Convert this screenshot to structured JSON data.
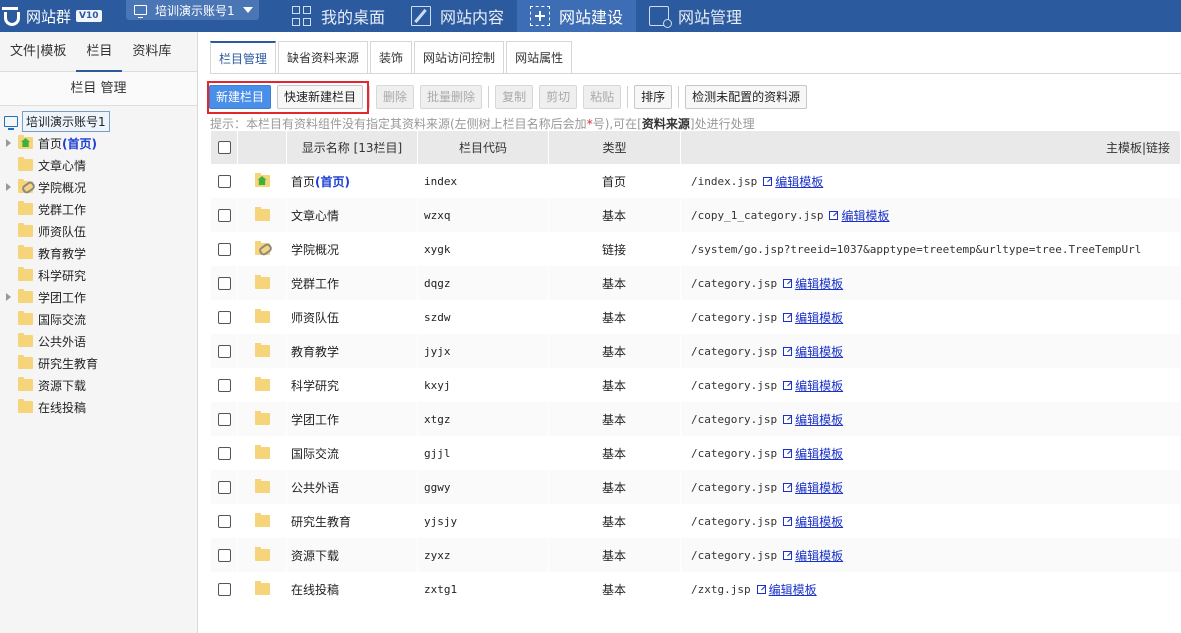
{
  "app": {
    "logo_text": "网站群",
    "version": "V10",
    "account": "培训演示账号1"
  },
  "topnav": [
    {
      "label": "我的桌面",
      "icon": "desktop-icon"
    },
    {
      "label": "网站内容",
      "icon": "edit-icon"
    },
    {
      "label": "网站建设",
      "icon": "build-icon",
      "active": true
    },
    {
      "label": "网站管理",
      "icon": "manage-icon"
    }
  ],
  "left": {
    "tabs": [
      "文件|模板",
      "栏目",
      "资料库"
    ],
    "active_tab": "栏目",
    "title": "栏目 管理",
    "root": "培训演示账号1",
    "tree": [
      {
        "label": "首页",
        "tag": "(首页)",
        "expandable": true,
        "icon": "home-folder-icon"
      },
      {
        "label": "文章心情",
        "expandable": false,
        "icon": "folder-icon"
      },
      {
        "label": "学院概况",
        "expandable": true,
        "icon": "link-folder-icon"
      },
      {
        "label": "党群工作",
        "expandable": false,
        "icon": "folder-icon"
      },
      {
        "label": "师资队伍",
        "expandable": false,
        "icon": "folder-icon"
      },
      {
        "label": "教育教学",
        "expandable": false,
        "icon": "folder-icon"
      },
      {
        "label": "科学研究",
        "expandable": false,
        "icon": "folder-icon"
      },
      {
        "label": "学团工作",
        "expandable": true,
        "icon": "folder-icon"
      },
      {
        "label": "国际交流",
        "expandable": false,
        "icon": "folder-icon"
      },
      {
        "label": "公共外语",
        "expandable": false,
        "icon": "folder-icon"
      },
      {
        "label": "研究生教育",
        "expandable": false,
        "icon": "folder-icon"
      },
      {
        "label": "资源下载",
        "expandable": false,
        "icon": "folder-icon"
      },
      {
        "label": "在线投稿",
        "expandable": false,
        "icon": "folder-icon"
      }
    ]
  },
  "main": {
    "tabs": [
      "栏目管理",
      "缺省资料来源",
      "装饰",
      "网站访问控制",
      "网站属性"
    ],
    "toolbar": {
      "new": "新建栏目",
      "quick_new": "快速新建栏目",
      "delete": "删除",
      "batch_delete": "批量删除",
      "copy": "复制",
      "cut": "剪切",
      "paste": "粘贴",
      "sort": "排序",
      "check": "检测未配置的资料源"
    },
    "hint": {
      "prefix": "提示：本栏目有资料组件没有指定其资料来源(左侧树上栏目名称后会加",
      "star": "*",
      "middle": "号),可在[",
      "source": "资料来源",
      "suffix": "]处进行处理"
    },
    "columns": {
      "name": "显示名称 [13栏目]",
      "code": "栏目代码",
      "type": "类型",
      "template": "主模板|链接"
    },
    "edit_label": "编辑模板",
    "rows": [
      {
        "name": "首页",
        "tag": "(首页)",
        "code": "index",
        "type": "首页",
        "template": "/index.jsp",
        "icon": "home-folder-icon",
        "editable": true
      },
      {
        "name": "文章心情",
        "code": "wzxq",
        "type": "基本",
        "template": "/copy_1_category.jsp",
        "icon": "folder-icon",
        "editable": true
      },
      {
        "name": "学院概况",
        "code": "xygk",
        "type": "链接",
        "template": "/system/go.jsp?treeid=1037&apptype=treetemp&urltype=tree.TreeTempUrl",
        "icon": "link-folder-icon",
        "editable": false
      },
      {
        "name": "党群工作",
        "code": "dqgz",
        "type": "基本",
        "template": "/category.jsp",
        "icon": "folder-icon",
        "editable": true
      },
      {
        "name": "师资队伍",
        "code": "szdw",
        "type": "基本",
        "template": "/category.jsp",
        "icon": "folder-icon",
        "editable": true
      },
      {
        "name": "教育教学",
        "code": "jyjx",
        "type": "基本",
        "template": "/category.jsp",
        "icon": "folder-icon",
        "editable": true
      },
      {
        "name": "科学研究",
        "code": "kxyj",
        "type": "基本",
        "template": "/category.jsp",
        "icon": "folder-icon",
        "editable": true
      },
      {
        "name": "学团工作",
        "code": "xtgz",
        "type": "基本",
        "template": "/category.jsp",
        "icon": "folder-icon",
        "editable": true
      },
      {
        "name": "国际交流",
        "code": "gjjl",
        "type": "基本",
        "template": "/category.jsp",
        "icon": "folder-icon",
        "editable": true
      },
      {
        "name": "公共外语",
        "code": "ggwy",
        "type": "基本",
        "template": "/category.jsp",
        "icon": "folder-icon",
        "editable": true
      },
      {
        "name": "研究生教育",
        "code": "yjsjy",
        "type": "基本",
        "template": "/category.jsp",
        "icon": "folder-icon",
        "editable": true
      },
      {
        "name": "资源下载",
        "code": "zyxz",
        "type": "基本",
        "template": "/category.jsp",
        "icon": "folder-icon",
        "editable": true
      },
      {
        "name": "在线投稿",
        "code": "zxtg1",
        "type": "基本",
        "template": "/zxtg.jsp",
        "icon": "folder-icon",
        "editable": true
      }
    ]
  },
  "colors": {
    "topbar": "#2b5a9e",
    "primary_button": "#4a8fe7",
    "highlight_border": "#e4262e",
    "link": "#1a32c8"
  }
}
